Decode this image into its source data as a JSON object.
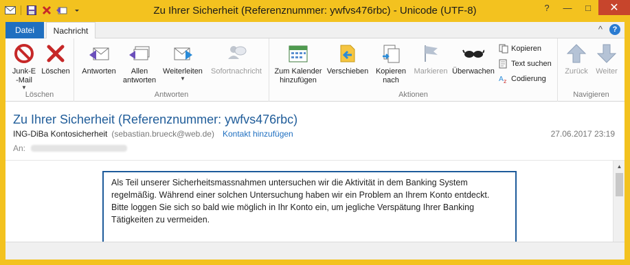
{
  "window": {
    "title": "Zu Ihrer Sicherheit (Referenznummer: ywfvs476rbc) - Unicode (UTF-8)",
    "controls": {
      "help": "?",
      "minimize": "—",
      "maximize": "□",
      "close": "✕"
    }
  },
  "tabs": [
    {
      "label": "Datei"
    },
    {
      "label": "Nachricht"
    }
  ],
  "ribbon": {
    "groups": [
      {
        "label": "Löschen"
      },
      {
        "label": "Antworten"
      },
      {
        "label": "Aktionen"
      },
      {
        "label": "Navigieren"
      }
    ],
    "buttons": {
      "junk": "Junk-E\n-Mail",
      "delete": "Löschen",
      "reply": "Antworten",
      "reply_all": "Allen\nantworten",
      "forward": "Weiterleiten",
      "im": "Sofortnachricht",
      "calendar": "Zum Kalender\nhinzufügen",
      "move": "Verschieben",
      "copy_to": "Kopieren\nnach",
      "flag": "Markieren",
      "watch": "Überwachen",
      "copy": "Kopieren",
      "find": "Text suchen",
      "encoding": "Codierung",
      "back": "Zurück",
      "next": "Weiter"
    }
  },
  "message": {
    "subject": "Zu Ihrer Sicherheit (Referenznummer: ywfvs476rbc)",
    "sender_name": "ING-DiBa Kontosicherheit",
    "sender_email": "(sebastian.brueck@web.de)",
    "add_contact": "Kontakt hinzufügen",
    "datetime": "27.06.2017 23:19",
    "to_label": "An:",
    "body_p1": "Als Teil unserer Sicherheitsmassnahmen untersuchen wir die Aktivität in dem Banking System regelmäßig. Während einer solchen Untersuchung haben wir ein Problem an Ihrem Konto entdeckt.",
    "body_p2": "Bitte loggen Sie sich so bald wie möglich in Ihr Konto ein, um jegliche Verspätung Ihrer Banking Tätigkeiten zu vermeiden."
  }
}
